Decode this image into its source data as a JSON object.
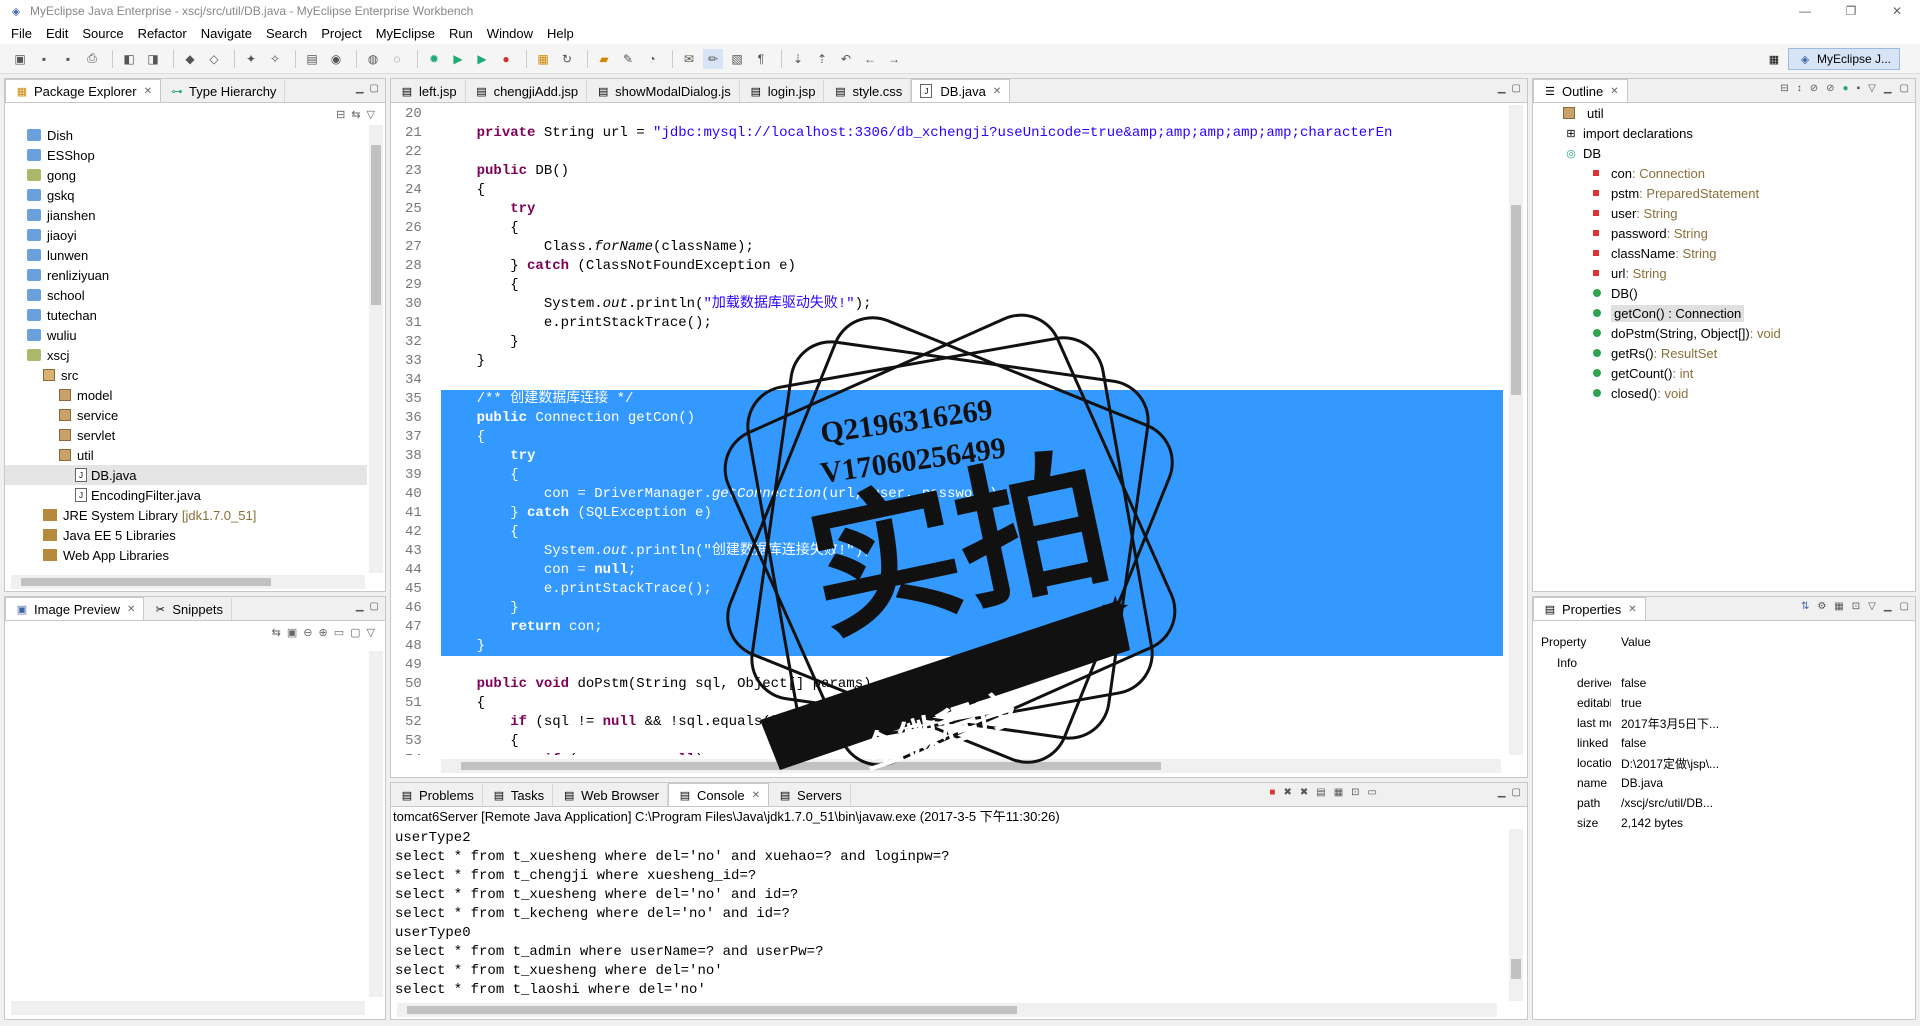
{
  "window": {
    "title": "MyEclipse Java Enterprise - xscj/src/util/DB.java - MyEclipse Enterprise Workbench",
    "controls": [
      "—",
      "❐",
      "✕"
    ]
  },
  "menu": [
    "File",
    "Edit",
    "Source",
    "Refactor",
    "Navigate",
    "Search",
    "Project",
    "MyEclipse",
    "Run",
    "Window",
    "Help"
  ],
  "perspective": {
    "label": "MyEclipse J..."
  },
  "package_explorer": {
    "tabs": [
      "Package Explorer",
      "Type Hierarchy"
    ],
    "items": [
      {
        "label": "Dish",
        "type": "folder",
        "indent": 0
      },
      {
        "label": "ESShop",
        "type": "folder",
        "indent": 0
      },
      {
        "label": "gong",
        "type": "folder2",
        "indent": 0
      },
      {
        "label": "gskq",
        "type": "folder",
        "indent": 0
      },
      {
        "label": "jianshen",
        "type": "folder",
        "indent": 0
      },
      {
        "label": "jiaoyi",
        "type": "folder",
        "indent": 0
      },
      {
        "label": "lunwen",
        "type": "folder",
        "indent": 0
      },
      {
        "label": "renliziyuan",
        "type": "folder",
        "indent": 0
      },
      {
        "label": "school",
        "type": "folder",
        "indent": 0
      },
      {
        "label": "tutechan",
        "type": "folder",
        "indent": 0
      },
      {
        "label": "wuliu",
        "type": "folder",
        "indent": 0
      },
      {
        "label": "xscj",
        "type": "folder2",
        "indent": 0
      },
      {
        "label": "src",
        "type": "src",
        "indent": 1
      },
      {
        "label": "model",
        "type": "pkg",
        "indent": 2
      },
      {
        "label": "service",
        "type": "pkg",
        "indent": 2
      },
      {
        "label": "servlet",
        "type": "pkg",
        "indent": 2
      },
      {
        "label": "util",
        "type": "pkg",
        "indent": 2
      },
      {
        "label": "DB.java",
        "type": "java",
        "indent": 3,
        "selected": true
      },
      {
        "label": "EncodingFilter.java",
        "type": "java",
        "indent": 3
      },
      {
        "label": "JRE System Library",
        "suffix": "[jdk1.7.0_51]",
        "type": "lib",
        "indent": 1
      },
      {
        "label": "Java EE 5 Libraries",
        "type": "lib",
        "indent": 1
      },
      {
        "label": "Web App Libraries",
        "type": "lib",
        "indent": 1
      }
    ]
  },
  "image_preview": {
    "tabs": [
      "Image Preview",
      "Snippets"
    ]
  },
  "editor": {
    "tabs": [
      "left.jsp",
      "chengjiAdd.jsp",
      "showModalDialog.js",
      "login.jsp",
      "style.css",
      "DB.java"
    ],
    "active_tab": "DB.java",
    "lines": [
      {
        "n": "20",
        "html": ""
      },
      {
        "n": "21",
        "html": "    <span class='kw'>private</span> String url = <span class='str'>\"jdbc:mysql://localhost:3306/db_xchengji?useUnicode=true&amp;amp;amp;amp;amp;amp;characterEn</span>"
      },
      {
        "n": "22",
        "html": ""
      },
      {
        "n": "23",
        "html": "    <span class='kw'>public</span> DB()"
      },
      {
        "n": "24",
        "html": "    {"
      },
      {
        "n": "25",
        "html": "        <span class='kw'>try</span>"
      },
      {
        "n": "26",
        "html": "        {"
      },
      {
        "n": "27",
        "html": "            Class.<span class='it'>forName</span>(className);"
      },
      {
        "n": "28",
        "html": "        } <span class='kw'>catch</span> (ClassNotFoundException e)"
      },
      {
        "n": "29",
        "html": "        {"
      },
      {
        "n": "30",
        "html": "            System.<span class='it'>out</span>.println(<span class='str'>\"加载数据库驱动失败!\"</span>);"
      },
      {
        "n": "31",
        "html": "            e.printStackTrace();"
      },
      {
        "n": "32",
        "html": "        }"
      },
      {
        "n": "33",
        "html": "    }"
      },
      {
        "n": "34",
        "html": ""
      },
      {
        "n": "35",
        "html": "    <span class='cm'>/** 创建数据库连接 */</span>",
        "sel": true
      },
      {
        "n": "36",
        "html": "    <span class='kw'>public</span> Connection getCon()",
        "sel": true
      },
      {
        "n": "37",
        "html": "    {",
        "sel": true
      },
      {
        "n": "38",
        "html": "        <span class='kw'>try</span>",
        "sel": true
      },
      {
        "n": "39",
        "html": "        {",
        "sel": true
      },
      {
        "n": "40",
        "html": "            con = DriverManager.<span class='it'>getConnection</span>(url, user, password);",
        "sel": true
      },
      {
        "n": "41",
        "html": "        } <span class='kw'>catch</span> (SQLException e)",
        "sel": true
      },
      {
        "n": "42",
        "html": "        {",
        "sel": true
      },
      {
        "n": "43",
        "html": "            System.<span class='it'>out</span>.println(<span class='str'>\"创建数据库连接失败!\"</span>);",
        "sel": true
      },
      {
        "n": "44",
        "html": "            con = <span class='kw'>null</span>;",
        "sel": true
      },
      {
        "n": "45",
        "html": "            e.printStackTrace();",
        "sel": true
      },
      {
        "n": "46",
        "html": "        }",
        "sel": true
      },
      {
        "n": "47",
        "html": "        <span class='kw'>return</span> con;",
        "sel": true
      },
      {
        "n": "48",
        "html": "    }",
        "sel": true
      },
      {
        "n": "49",
        "html": ""
      },
      {
        "n": "50",
        "html": "    <span class='kw'>public</span> <span class='kw'>void</span> doPstm(String sql, Object[] params)"
      },
      {
        "n": "51",
        "html": "    {"
      },
      {
        "n": "52",
        "html": "        <span class='kw'>if</span> (sql != <span class='kw'>null</span> &amp;&amp; !sql.equals(<span class='str'>\"\"</span>))"
      },
      {
        "n": "53",
        "html": "        {"
      },
      {
        "n": "54",
        "html": "            <span class='kw'>if</span> (params == <span class='kw'>null</span>)"
      }
    ]
  },
  "console": {
    "tabs": [
      "Problems",
      "Tasks",
      "Web Browser",
      "Console",
      "Servers"
    ],
    "active_tab": "Console",
    "header": "tomcat6Server [Remote Java Application] C:\\Program Files\\Java\\jdk1.7.0_51\\bin\\javaw.exe (2017-3-5 下午11:30:26)",
    "lines": [
      "userType2",
      "select * from t_xuesheng where del='no' and xuehao=? and loginpw=?",
      "select * from t_chengji where xuesheng_id=?",
      "select * from t_xuesheng where del='no' and id=?",
      "select * from t_kecheng where del='no' and id=?",
      "userType0",
      "select * from t_admin where userName=? and userPw=?",
      "select * from t_xuesheng where del='no'",
      "select * from t_laoshi where del='no'"
    ]
  },
  "outline": {
    "tab": "Outline",
    "items": [
      {
        "label": "util",
        "type": "pkg",
        "indent": 0
      },
      {
        "label": "import declarations",
        "type": "imp",
        "indent": 0
      },
      {
        "label": "DB",
        "type": "class",
        "indent": 0
      },
      {
        "label": "con",
        "t": " : Connection",
        "type": "field",
        "indent": 1
      },
      {
        "label": "pstm",
        "t": " : PreparedStatement",
        "type": "field",
        "indent": 1
      },
      {
        "label": "user",
        "t": " : String",
        "type": "field",
        "indent": 1
      },
      {
        "label": "password",
        "t": " : String",
        "type": "field",
        "indent": 1
      },
      {
        "label": "className",
        "t": " : String",
        "type": "field",
        "indent": 1
      },
      {
        "label": "url",
        "t": " : String",
        "type": "field",
        "indent": 1
      },
      {
        "label": "DB()",
        "t": "",
        "type": "ctor",
        "indent": 1
      },
      {
        "label": "getCon() : Connection",
        "t": "",
        "type": "method",
        "indent": 1,
        "selected": true
      },
      {
        "label": "doPstm(String, Object[])",
        "t": " : void",
        "type": "method",
        "indent": 1
      },
      {
        "label": "getRs()",
        "t": " : ResultSet",
        "type": "method",
        "indent": 1
      },
      {
        "label": "getCount()",
        "t": " : int",
        "type": "method",
        "indent": 1
      },
      {
        "label": "closed()",
        "t": " : void",
        "type": "method",
        "indent": 1
      }
    ]
  },
  "properties": {
    "tab": "Properties",
    "col_property": "Property",
    "col_value": "Value",
    "group": "Info",
    "rows": [
      {
        "k": "derived",
        "v": "false"
      },
      {
        "k": "editable",
        "v": "true"
      },
      {
        "k": "last modified",
        "v": "2017年3月5日下..."
      },
      {
        "k": "linked",
        "v": "false"
      },
      {
        "k": "location",
        "v": "D:\\2017定做\\jsp\\..."
      },
      {
        "k": "name",
        "v": "DB.java"
      },
      {
        "k": "path",
        "v": "/xscj/src/util/DB..."
      },
      {
        "k": "size",
        "v": "2,142  bytes"
      }
    ]
  },
  "watermark": {
    "line1": "Q2196316269",
    "line2": "V17060256499",
    "big": "实拍",
    "ribbon": "全微程序"
  }
}
